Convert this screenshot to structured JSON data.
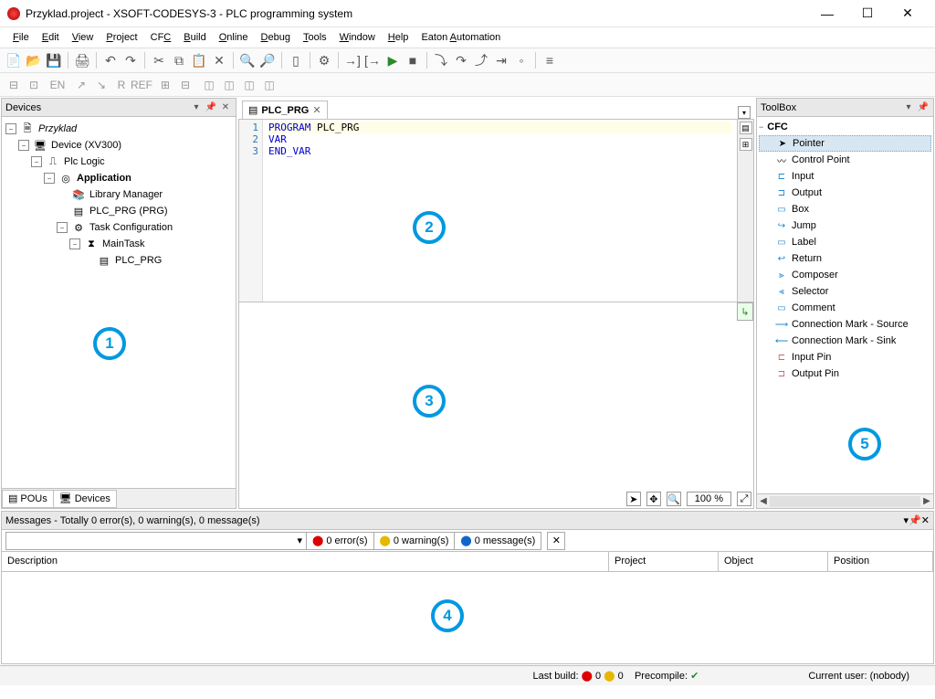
{
  "window": {
    "title": "Przyklad.project - XSOFT-CODESYS-3 - PLC programming system"
  },
  "menu": {
    "file": "File",
    "edit": "Edit",
    "view": "View",
    "project": "Project",
    "cfc": "CFC",
    "build": "Build",
    "online": "Online",
    "debug": "Debug",
    "tools": "Tools",
    "window": "Window",
    "help": "Help",
    "eaton": "Eaton Automation"
  },
  "devices_panel": {
    "title": "Devices",
    "tabs": {
      "pous": "POUs",
      "devices": "Devices"
    },
    "tree": {
      "root": "Przyklad",
      "device": "Device (XV300)",
      "plclogic": "Plc Logic",
      "application": "Application",
      "library": "Library Manager",
      "plc_prg": "PLC_PRG (PRG)",
      "taskcfg": "Task Configuration",
      "maintask": "MainTask",
      "plc_prg2": "PLC_PRG"
    }
  },
  "editor": {
    "tab_label": "PLC_PRG",
    "code": {
      "l1a": "PROGRAM",
      "l1b": " PLC_PRG",
      "l2": "VAR",
      "l3": "END_VAR"
    },
    "zoom": "100 %"
  },
  "toolbox": {
    "title": "ToolBox",
    "category": "CFC",
    "items": {
      "pointer": "Pointer",
      "controlpoint": "Control Point",
      "input": "Input",
      "output": "Output",
      "box": "Box",
      "jump": "Jump",
      "label": "Label",
      "return": "Return",
      "composer": "Composer",
      "selector": "Selector",
      "comment": "Comment",
      "cms": "Connection Mark - Source",
      "cmk": "Connection Mark - Sink",
      "inputpin": "Input Pin",
      "outputpin": "Output Pin"
    }
  },
  "messages": {
    "title": "Messages - Totally 0 error(s), 0 warning(s), 0 message(s)",
    "errors": "0 error(s)",
    "warnings": "0 warning(s)",
    "infos": "0 message(s)",
    "cols": {
      "description": "Description",
      "project": "Project",
      "object": "Object",
      "position": "Position"
    }
  },
  "status": {
    "lastbuild": "Last build:",
    "lb_err": "0",
    "lb_warn": "0",
    "precompile": "Precompile:",
    "user": "Current user: (nobody)"
  },
  "annotations": {
    "n1": "1",
    "n2": "2",
    "n3": "3",
    "n4": "4",
    "n5": "5"
  }
}
